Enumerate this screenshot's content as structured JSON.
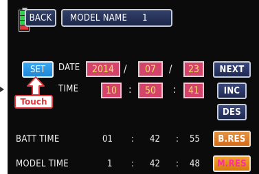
{
  "header": {
    "back_label": "BACK",
    "model_name_label": "MODEL NAME",
    "model_number": "1"
  },
  "set_button": "SET",
  "date": {
    "label": "DATE",
    "year": "2014",
    "month": "07",
    "day": "23",
    "separator": "/"
  },
  "time": {
    "label": "TIME",
    "hour": "10",
    "minute": "50",
    "second": "41",
    "separator": ":"
  },
  "side_buttons": {
    "next": "NEXT",
    "inc": "INC",
    "des": "DES",
    "bres": "B.RES",
    "mres": "M.RES"
  },
  "batt_time": {
    "label": "BATT TIME",
    "h": "01",
    "m": "42",
    "s": "55",
    "separator": ":"
  },
  "model_time": {
    "label": "MODEL TIME",
    "h": "1",
    "m": "42",
    "s": "48",
    "separator": ":"
  },
  "callout": {
    "label": "Touch"
  },
  "colors": {
    "value_box": "#d4446a",
    "value_text": "#f8e36a",
    "set_button": "#2a9ae6",
    "reset_button": "#e07f2a",
    "callout": "#e0393e"
  }
}
